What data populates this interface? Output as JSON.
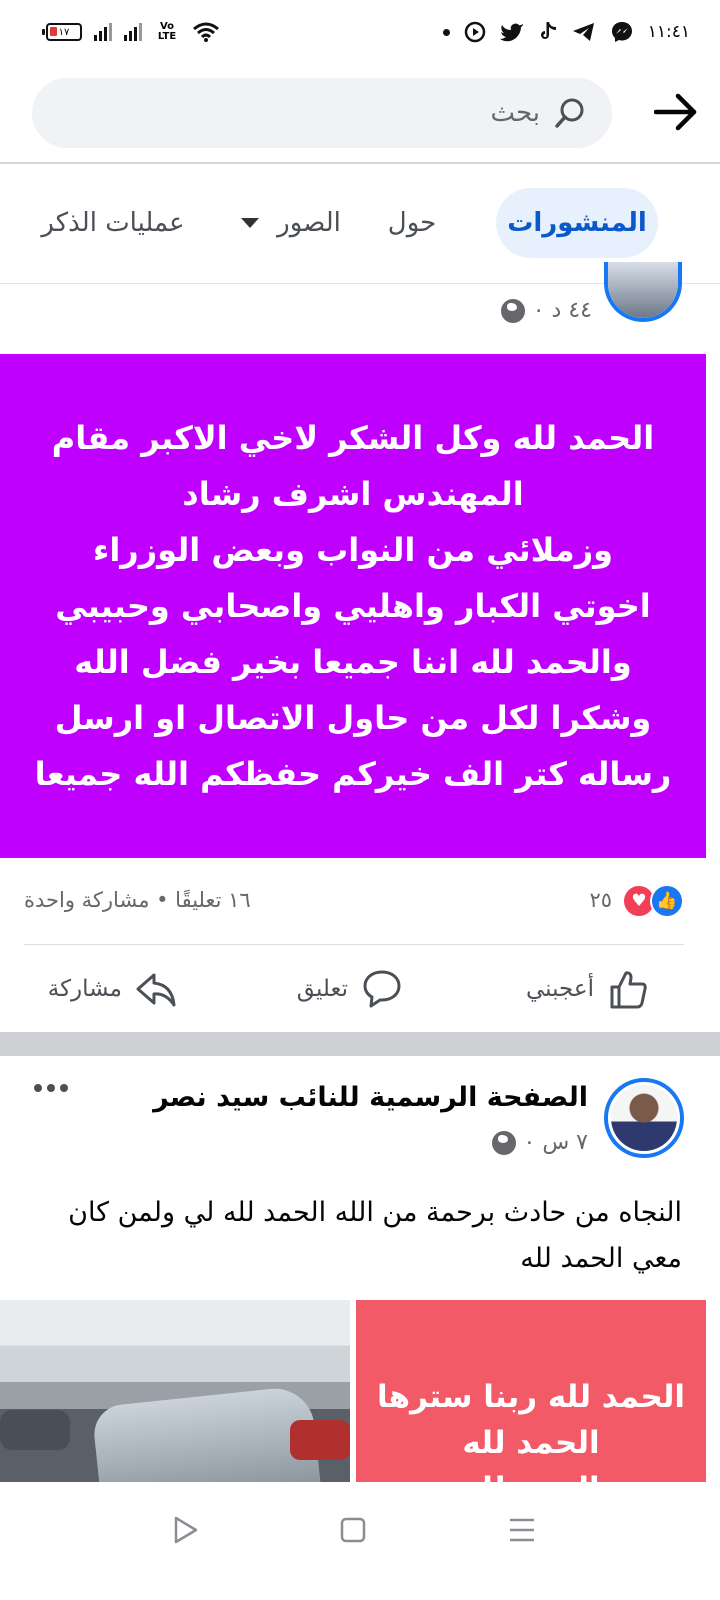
{
  "status_bar": {
    "time": "١١:٤١",
    "battery": "١٧",
    "network_label": "Vo LTE"
  },
  "search": {
    "placeholder": "بحث"
  },
  "tabs": [
    {
      "label": "المنشورات",
      "active": true
    },
    {
      "label": "حول",
      "active": false
    },
    {
      "label": "الصور",
      "active": false
    },
    {
      "label": "عمليات الذكر",
      "active": false
    }
  ],
  "post1": {
    "time": "٤٤ د ٠",
    "text_lines": [
      "الحمد لله وكل الشكر لاخي الاكبر مقام",
      "المهندس اشرف رشاد",
      "وزملائي من النواب وبعض  الوزراء",
      "اخوتي الكبار واهليي واصحابي وحبيبي",
      "والحمد لله اننا جميعا بخير فضل الله",
      "وشكرا لكل من حاول الاتصال او ارسل",
      "رساله كتر الف خيركم حفظكم الله جميعا"
    ],
    "background_color": "#c000ff",
    "reactions_count": "٢٥",
    "comments_shares": "١٦ تعليقًا • مشاركة واحدة"
  },
  "actions": {
    "like": "أعجبني",
    "comment": "تعليق",
    "share": "مشاركة"
  },
  "post2": {
    "page_name": "الصفحة الرسمية للنائب سيد نصر",
    "time": "٧ س ٠",
    "text": "النجاه من حادث برحمة من الله الحمد لله لي ولمن كان معي الحمد لله",
    "image_text_lines": [
      "الحمد لله ربنا سترها",
      "الحمد لله",
      "الحمد لله"
    ]
  },
  "colors": {
    "accent": "#1877f2",
    "tab_active_bg": "#e7f0fd"
  }
}
